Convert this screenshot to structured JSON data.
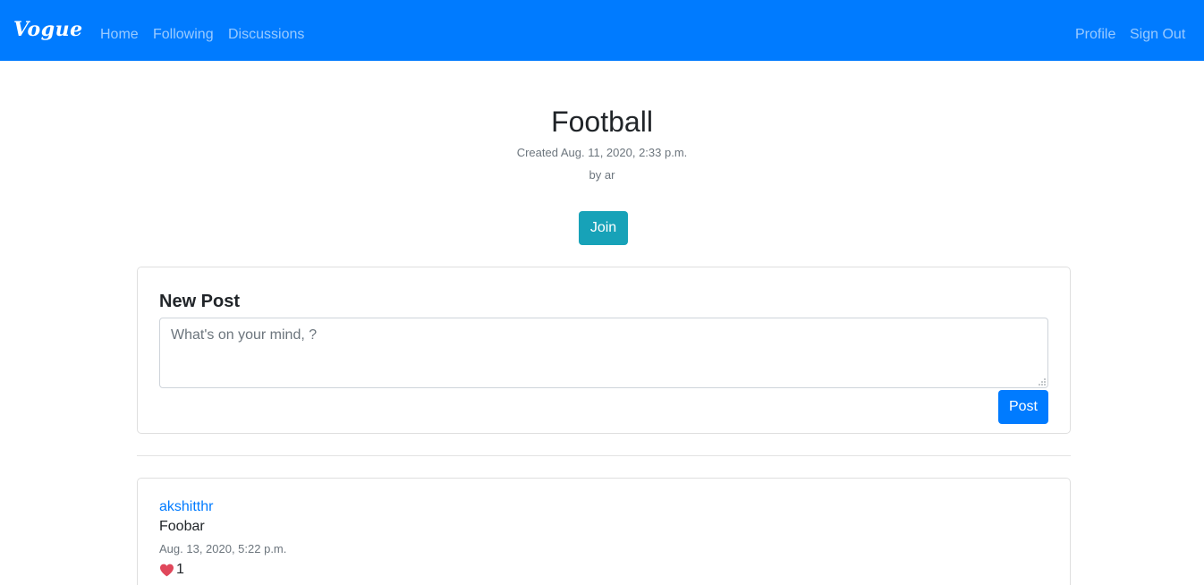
{
  "navbar": {
    "brand": "Vogue",
    "links": [
      "Home",
      "Following",
      "Discussions"
    ],
    "right_links": [
      "Profile",
      "Sign Out"
    ],
    "background": "#007bff"
  },
  "discussion": {
    "title": "Football",
    "created": "Created Aug. 11, 2020, 2:33 p.m.",
    "by": "by ar",
    "join_label": "Join",
    "join_color": "#17a2b8"
  },
  "new_post": {
    "heading": "New Post",
    "placeholder": "What's on your mind, ?",
    "post_label": "Post"
  },
  "posts": [
    {
      "author": "akshitthr",
      "body": "Foobar",
      "date": "Aug. 13, 2020, 5:22 p.m.",
      "likes": "1",
      "like_icon": "heart-icon",
      "heart_color": "#e0475b"
    }
  ]
}
